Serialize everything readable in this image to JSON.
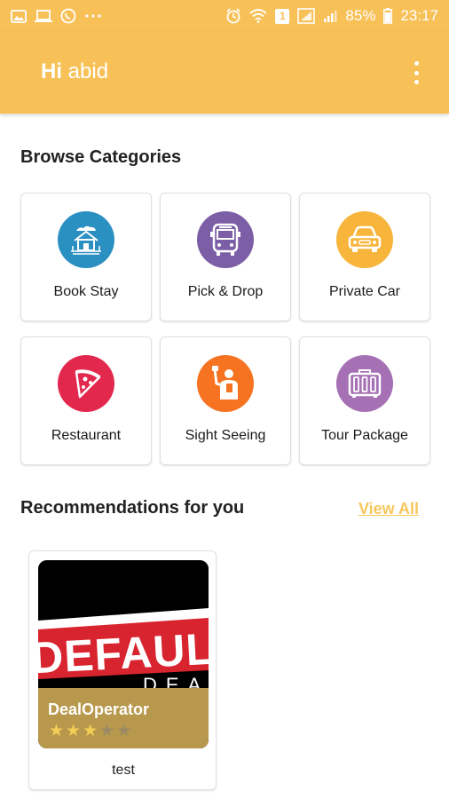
{
  "status_bar": {
    "battery": "85%",
    "time": "23:17",
    "notification_badge": "1",
    "left_icons": [
      "image-icon",
      "laptop-icon",
      "whatsapp-icon",
      "more-dots-icon"
    ],
    "right_icons": [
      "alarm-icon",
      "wifi-icon",
      "badge-icon",
      "signal-icon",
      "signal-icon",
      "battery-icon"
    ]
  },
  "header": {
    "greeting_prefix": "Hi",
    "user_name": "abid",
    "menu_icon": "more-vert-icon",
    "background_color": "#f8c158"
  },
  "browse": {
    "title": "Browse Categories",
    "categories": [
      {
        "label": "Book Stay",
        "icon": "house-icon",
        "color": "#2a8fc1"
      },
      {
        "label": "Pick & Drop",
        "icon": "bus-icon",
        "color": "#7b5ea5"
      },
      {
        "label": "Private Car",
        "icon": "car-icon",
        "color": "#f8b53c"
      },
      {
        "label": "Restaurant",
        "icon": "pizza-icon",
        "color": "#e3284e"
      },
      {
        "label": "Sight Seeing",
        "icon": "guide-icon",
        "color": "#f57321"
      },
      {
        "label": "Tour Package",
        "icon": "suitcase-icon",
        "color": "#a671b4"
      }
    ]
  },
  "recommendations": {
    "title": "Recommendations for you",
    "view_all": "View All",
    "accent_color": "#f6c65c",
    "items": [
      {
        "image_text": "DEFAUL",
        "image_subtext": "DEA",
        "operator": "DealOperator",
        "rating": 3,
        "rating_max": 5,
        "title": "test"
      }
    ]
  }
}
